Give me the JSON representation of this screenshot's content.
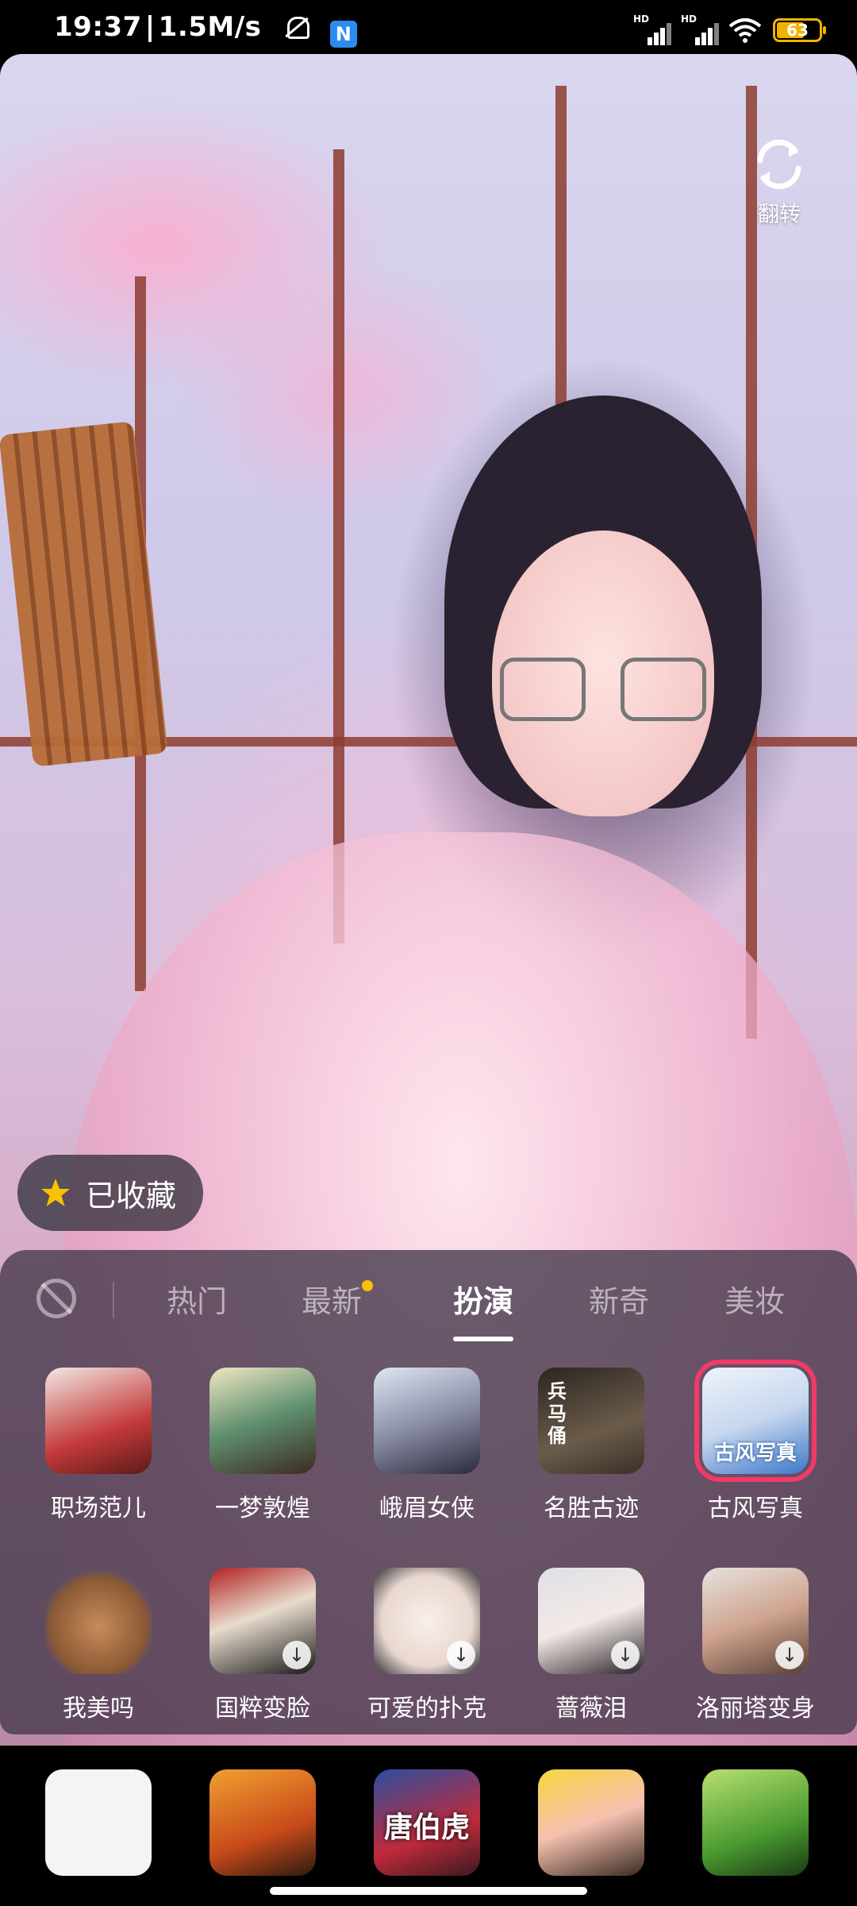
{
  "status_bar": {
    "time": "19:37",
    "net_speed": "1.5M/s",
    "notification_app_letter": "N",
    "signal_1_label": "HD",
    "signal_2_label": "HD",
    "battery": "63"
  },
  "camera": {
    "flip_label": "翻转"
  },
  "favorite_chip": {
    "label": "已收藏"
  },
  "tabs": [
    {
      "label": "热门"
    },
    {
      "label": "最新"
    },
    {
      "label": "扮演"
    },
    {
      "label": "新奇"
    },
    {
      "label": "美妆"
    }
  ],
  "active_tab": "扮演",
  "effects_row1": [
    {
      "name": "职场范儿"
    },
    {
      "name": "一梦敦煌"
    },
    {
      "name": "峨眉女侠"
    },
    {
      "name": "名胜古迹",
      "thumb_text": "兵马俑"
    },
    {
      "name": "古风写真",
      "thumb_text": "古风写真"
    }
  ],
  "effects_row2": [
    {
      "name": "我美吗"
    },
    {
      "name": "国粹变脸"
    },
    {
      "name": "可爱的扑克"
    },
    {
      "name": "蔷薇泪"
    },
    {
      "name": "洛丽塔变身"
    }
  ],
  "bottom_strip": [
    {
      "thumb_text": ""
    },
    {
      "thumb_text": ""
    },
    {
      "thumb_text": "唐伯虎"
    },
    {
      "thumb_text": ""
    },
    {
      "thumb_text": ""
    }
  ],
  "colors": {
    "selection_outline": "#ef3b68",
    "new_dot": "#f8c200",
    "battery": "#f0b400"
  }
}
